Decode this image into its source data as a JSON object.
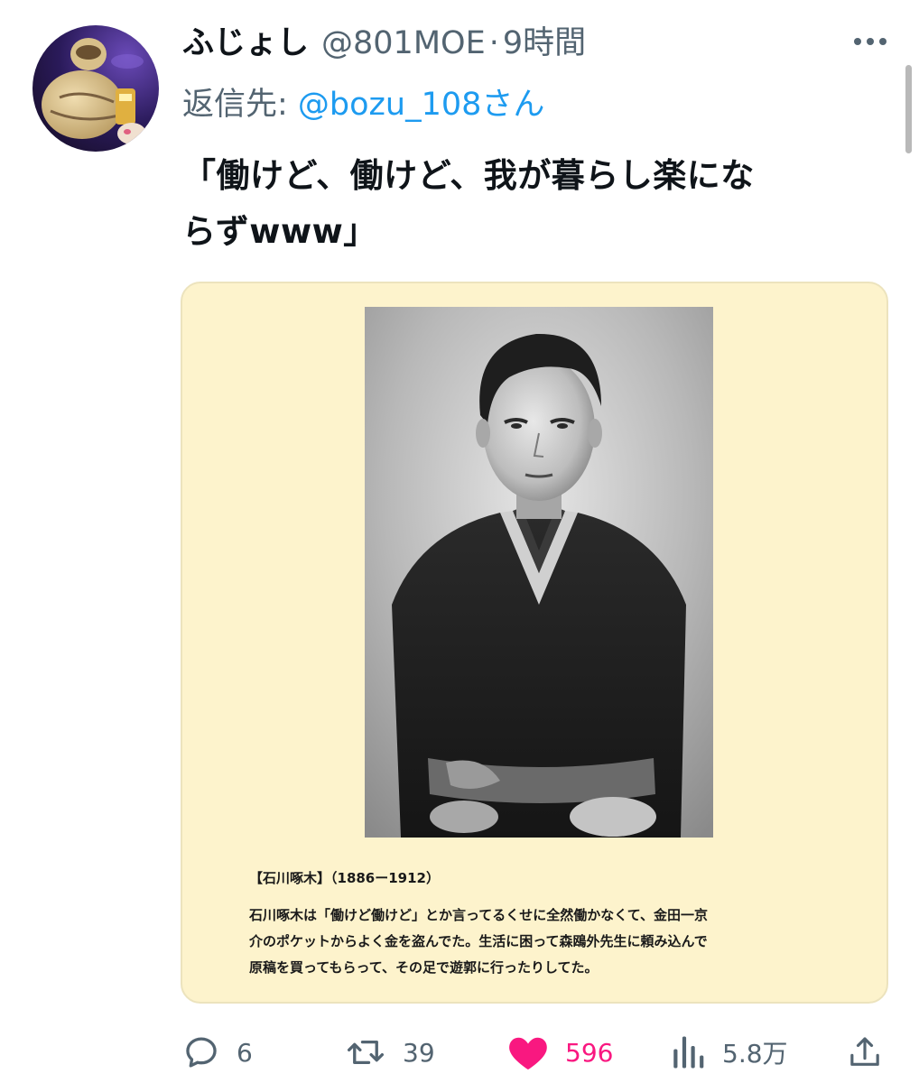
{
  "tweet": {
    "display_name": "ふじょし",
    "handle": "@801MOE",
    "separator": "·",
    "time": "9時間",
    "reply_prefix": "返信先: ",
    "reply_to": "@bozu_108さん",
    "text_lines": [
      "「働けど、働けど、我が暮らし楽にな",
      "らずwww」"
    ]
  },
  "media": {
    "caption_title": "【石川啄木】（1886ー1912）",
    "caption_lines": [
      "石川啄木は「働けど働けど」とか言ってるくせに全然働かなくて、金田一京",
      "介のポケットからよく金を盗んでた。生活に困って森鴎外先生に頼み込んで",
      "原稿を買ってもらって、その足で遊郭に行ったりしてた。"
    ]
  },
  "actions": {
    "replies": "6",
    "retweets": "39",
    "likes": "596",
    "views": "5.8万"
  },
  "icons": {
    "avatar": "avatar-character-icon",
    "more": "more-dots-icon",
    "reply": "reply-bubble-icon",
    "retweet": "retweet-icon",
    "like": "heart-icon",
    "views": "views-bars-icon",
    "share": "share-icon"
  },
  "colors": {
    "text": "#0f1419",
    "secondary": "#536471",
    "link": "#1d9bf0",
    "like": "#f91880",
    "card_bg": "#fdf3cc"
  }
}
